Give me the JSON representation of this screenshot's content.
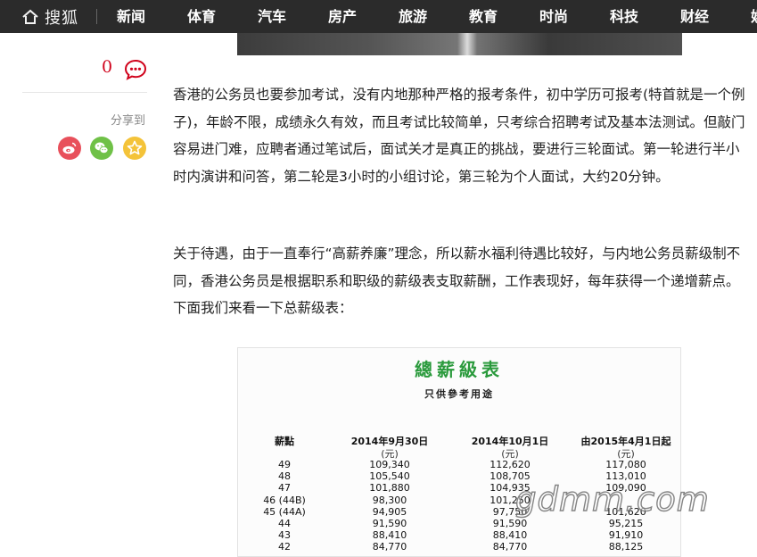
{
  "site": {
    "logo_text": "搜狐"
  },
  "nav": {
    "items": [
      "新闻",
      "体育",
      "汽车",
      "房产",
      "旅游",
      "教育",
      "时尚",
      "科技",
      "财经",
      "娱"
    ]
  },
  "sidebar": {
    "comment_count": "0",
    "share_label": "分享到"
  },
  "article": {
    "paragraph1": "香港的公务员也要参加考试，没有内地那种严格的报考条件，初中学历可报考(特首就是一个例子)，年龄不限，成绩永久有效，而且考试比较简单，只考综合招聘考试及基本法测试。但敲门容易进门难，应聘者通过笔试后，面试关才是真正的挑战，要进行三轮面试。第一轮进行半小时内演讲和问答，第二轮是3小时的小组讨论，第三轮为个人面试，大约20分钟。",
    "paragraph2": "关于待遇，由于一直奉行“高薪养廉”理念，所以薪水福利待遇比较好，与内地公务员薪级制不同，香港公务员是根据职系和职级的薪级表支取薪酬，工作表现好，每年获得一个递增薪点。下面我们来看一下总薪级表："
  },
  "salary_table": {
    "title": "總薪級表",
    "subtitle": "只供參考用途",
    "headers": [
      "薪點",
      "2014年9月30日",
      "2014年10月1日",
      "由2015年4月1日起"
    ],
    "units": [
      "",
      "(元)",
      "(元)",
      "(元)"
    ],
    "rows": [
      [
        "49",
        "109,340",
        "112,620",
        "117,080"
      ],
      [
        "48",
        "105,540",
        "108,705",
        "113,010"
      ],
      [
        "47",
        "101,880",
        "104,935",
        "109,090"
      ],
      [
        "46 (44B)",
        "98,300",
        "101,250",
        ""
      ],
      [
        "45 (44A)",
        "94,905",
        "97,750",
        "101,620"
      ],
      [
        "44",
        "91,590",
        "91,590",
        "95,215"
      ],
      [
        "43",
        "88,410",
        "88,410",
        "91,910"
      ],
      [
        "42",
        "84,770",
        "84,770",
        "88,125"
      ]
    ]
  },
  "watermark": "gdmm.com"
}
